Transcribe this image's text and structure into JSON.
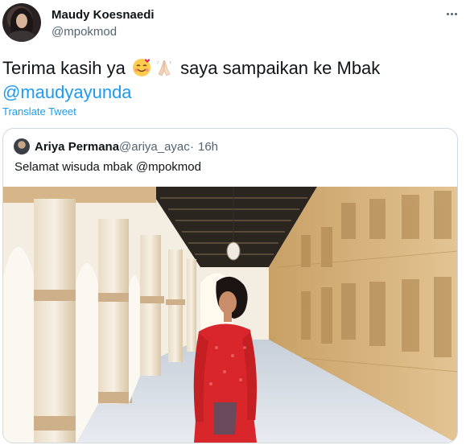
{
  "tweet": {
    "author_name": "Maudy Koesnaedi",
    "author_handle": "@mpokmod",
    "text_before_emoji": "Terima kasih ya ",
    "emoji_1": "smiling-face-with-hearts",
    "emoji_2": "folded-hands",
    "text_after_emoji": " saya sampaikan ke Mbak",
    "mention": "@maudyayunda",
    "translate_label": "Translate Tweet"
  },
  "quoted_tweet": {
    "author_name": "Ariya Permana",
    "author_handle": "@ariya_ayac",
    "separator": "·",
    "time": "16h",
    "text": "Selamat wisuda mbak @mpokmod",
    "photo": "woman-in-red-kebaya-in-arched-corridor"
  },
  "colors": {
    "link": "#1d9bf0",
    "secondary_text": "#536471",
    "border": "#cfd9de",
    "kebaya_red": "#d8262a"
  }
}
